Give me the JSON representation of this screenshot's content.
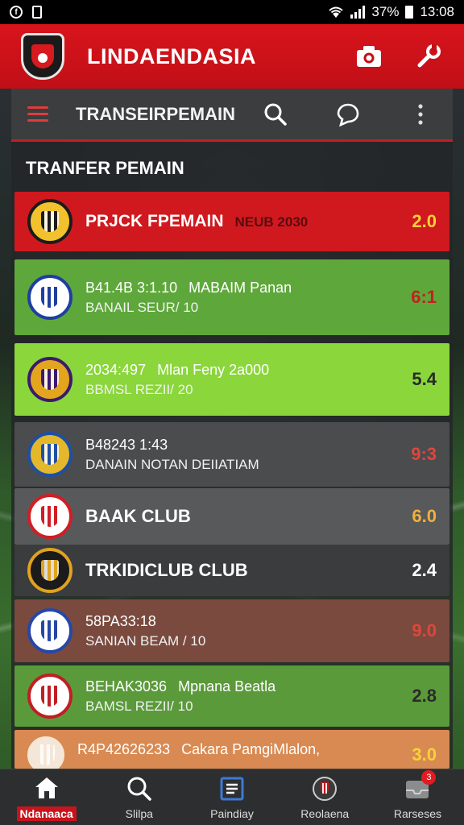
{
  "status_bar": {
    "battery": "37%",
    "time": "13:08"
  },
  "header": {
    "title": "LINDAENDASIA"
  },
  "toolbar": {
    "title": "TRANSEIRPEMAIN"
  },
  "list": {
    "title": "TRANFER PEMAIN",
    "items": [
      {
        "line1": "PRJCK FPEMAIN",
        "line1_extra": "NEUB 2030",
        "line2": "",
        "score": "2.0",
        "bg": "#d0191f",
        "score_color": "#f6d13a",
        "logo_bg": "#f2c12e",
        "logo_ring": "#1b1b1b"
      },
      {
        "line1": "B41.4B 3:1.10",
        "line1_extra": "MABAIM Panan",
        "line2": "BANAIL SEUR/ 10",
        "score": "6:1",
        "bg": "#5ea83b",
        "score_color": "#c0221c",
        "logo_bg": "#ffffff",
        "logo_ring": "#1e3fa0"
      },
      {
        "line1": "2034:497",
        "line1_extra": "Mlan Feny 2a000",
        "line2": "BBMSL REZII/ 20",
        "score": "5.4",
        "bg": "#8ad63b",
        "score_color": "#2a2a2a",
        "logo_bg": "#e3a51e",
        "logo_ring": "#3b1a6e"
      },
      {
        "line1": "B48243 1:43",
        "line1_extra": "",
        "line2": "DANAIN NOTAN DEIIATIAM",
        "score": "9:3",
        "bg": "#4a4c4e",
        "score_color": "#e0463b",
        "logo_bg": "#e3b82a",
        "logo_ring": "#1e4fa6"
      },
      {
        "line1": "BAAK CLUB",
        "line1_extra": "",
        "line2": "",
        "score": "6.0",
        "bg": "#58595b",
        "score_color": "#f2b03a",
        "logo_bg": "#ffffff",
        "logo_ring": "#d01e24"
      },
      {
        "line1": "TRKIDICLUB CLUB",
        "line1_extra": "",
        "line2": "",
        "score": "2.4",
        "bg": "#3a3c3d",
        "score_color": "#ffffff",
        "logo_bg": "#1b1b1b",
        "logo_ring": "#e0a31f"
      },
      {
        "line1": "58PA33:18",
        "line1_extra": "",
        "line2": "SANIAN BEAM / 10",
        "score": "9.0",
        "bg": "#7a4a3e",
        "score_color": "#e0463b",
        "logo_bg": "#ffffff",
        "logo_ring": "#2547a8"
      },
      {
        "line1": "BEHAK3036",
        "line1_extra": "Mpnana Beatla",
        "line2": "BAMSL REZII/ 10",
        "score": "2.8",
        "bg": "#5b9a3a",
        "score_color": "#2a2a2a",
        "logo_bg": "#ffffff",
        "logo_ring": "#c01e24"
      },
      {
        "line1": "R4P42626233",
        "line1_extra": "Cakara PamgiMlalon,",
        "line2": "",
        "score": "3.0",
        "bg": "#d98a52",
        "score_color": "#f6d13a",
        "logo_bg": "#f4e7d8",
        "logo_ring": "#f4e7d8"
      }
    ]
  },
  "bottom_nav": [
    {
      "label": "Ndanaaca",
      "icon": "home-icon"
    },
    {
      "label": "Slilpa",
      "icon": "search-icon"
    },
    {
      "label": "Paindiay",
      "icon": "news-icon"
    },
    {
      "label": "Reolaena",
      "icon": "club-icon"
    },
    {
      "label": "Rarseses",
      "icon": "inbox-icon",
      "badge": "3"
    }
  ]
}
